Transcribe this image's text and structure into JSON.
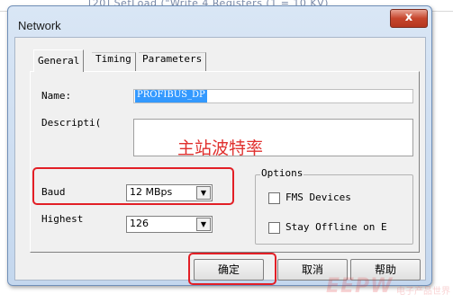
{
  "background": {
    "snippet": "[20] SetLoad (\"Write 4 Registers (1 = 10 KV)"
  },
  "window": {
    "title": "Network",
    "close_glyph": "x"
  },
  "tabs": [
    {
      "label": "General",
      "active": true
    },
    {
      "label": "Timing",
      "active": false
    },
    {
      "label": "Parameters",
      "active": false
    }
  ],
  "fields": {
    "name_label": "Name:",
    "name_value": "PROFIBUS_DP",
    "description_label": "Descripti(",
    "baud_label": "Baud",
    "baud_value": "12 MBps",
    "highest_label": "Highest",
    "highest_value": "126"
  },
  "options": {
    "title": "Options",
    "fms_label": "FMS Devices",
    "fms_checked": false,
    "offline_label": "Stay Offline on E",
    "offline_checked": false
  },
  "annotation": {
    "text": "主站波特率",
    "color": "#e0302e"
  },
  "buttons": {
    "ok": "确定",
    "cancel": "取消",
    "help": "帮助"
  },
  "watermark": {
    "text": "EEPW",
    "sub": "电子产品世界"
  },
  "colors": {
    "highlight": "#e21f26",
    "selection": "#3399ff"
  },
  "icons": {
    "dropdown": "chevron-down-icon",
    "close": "close-icon"
  }
}
